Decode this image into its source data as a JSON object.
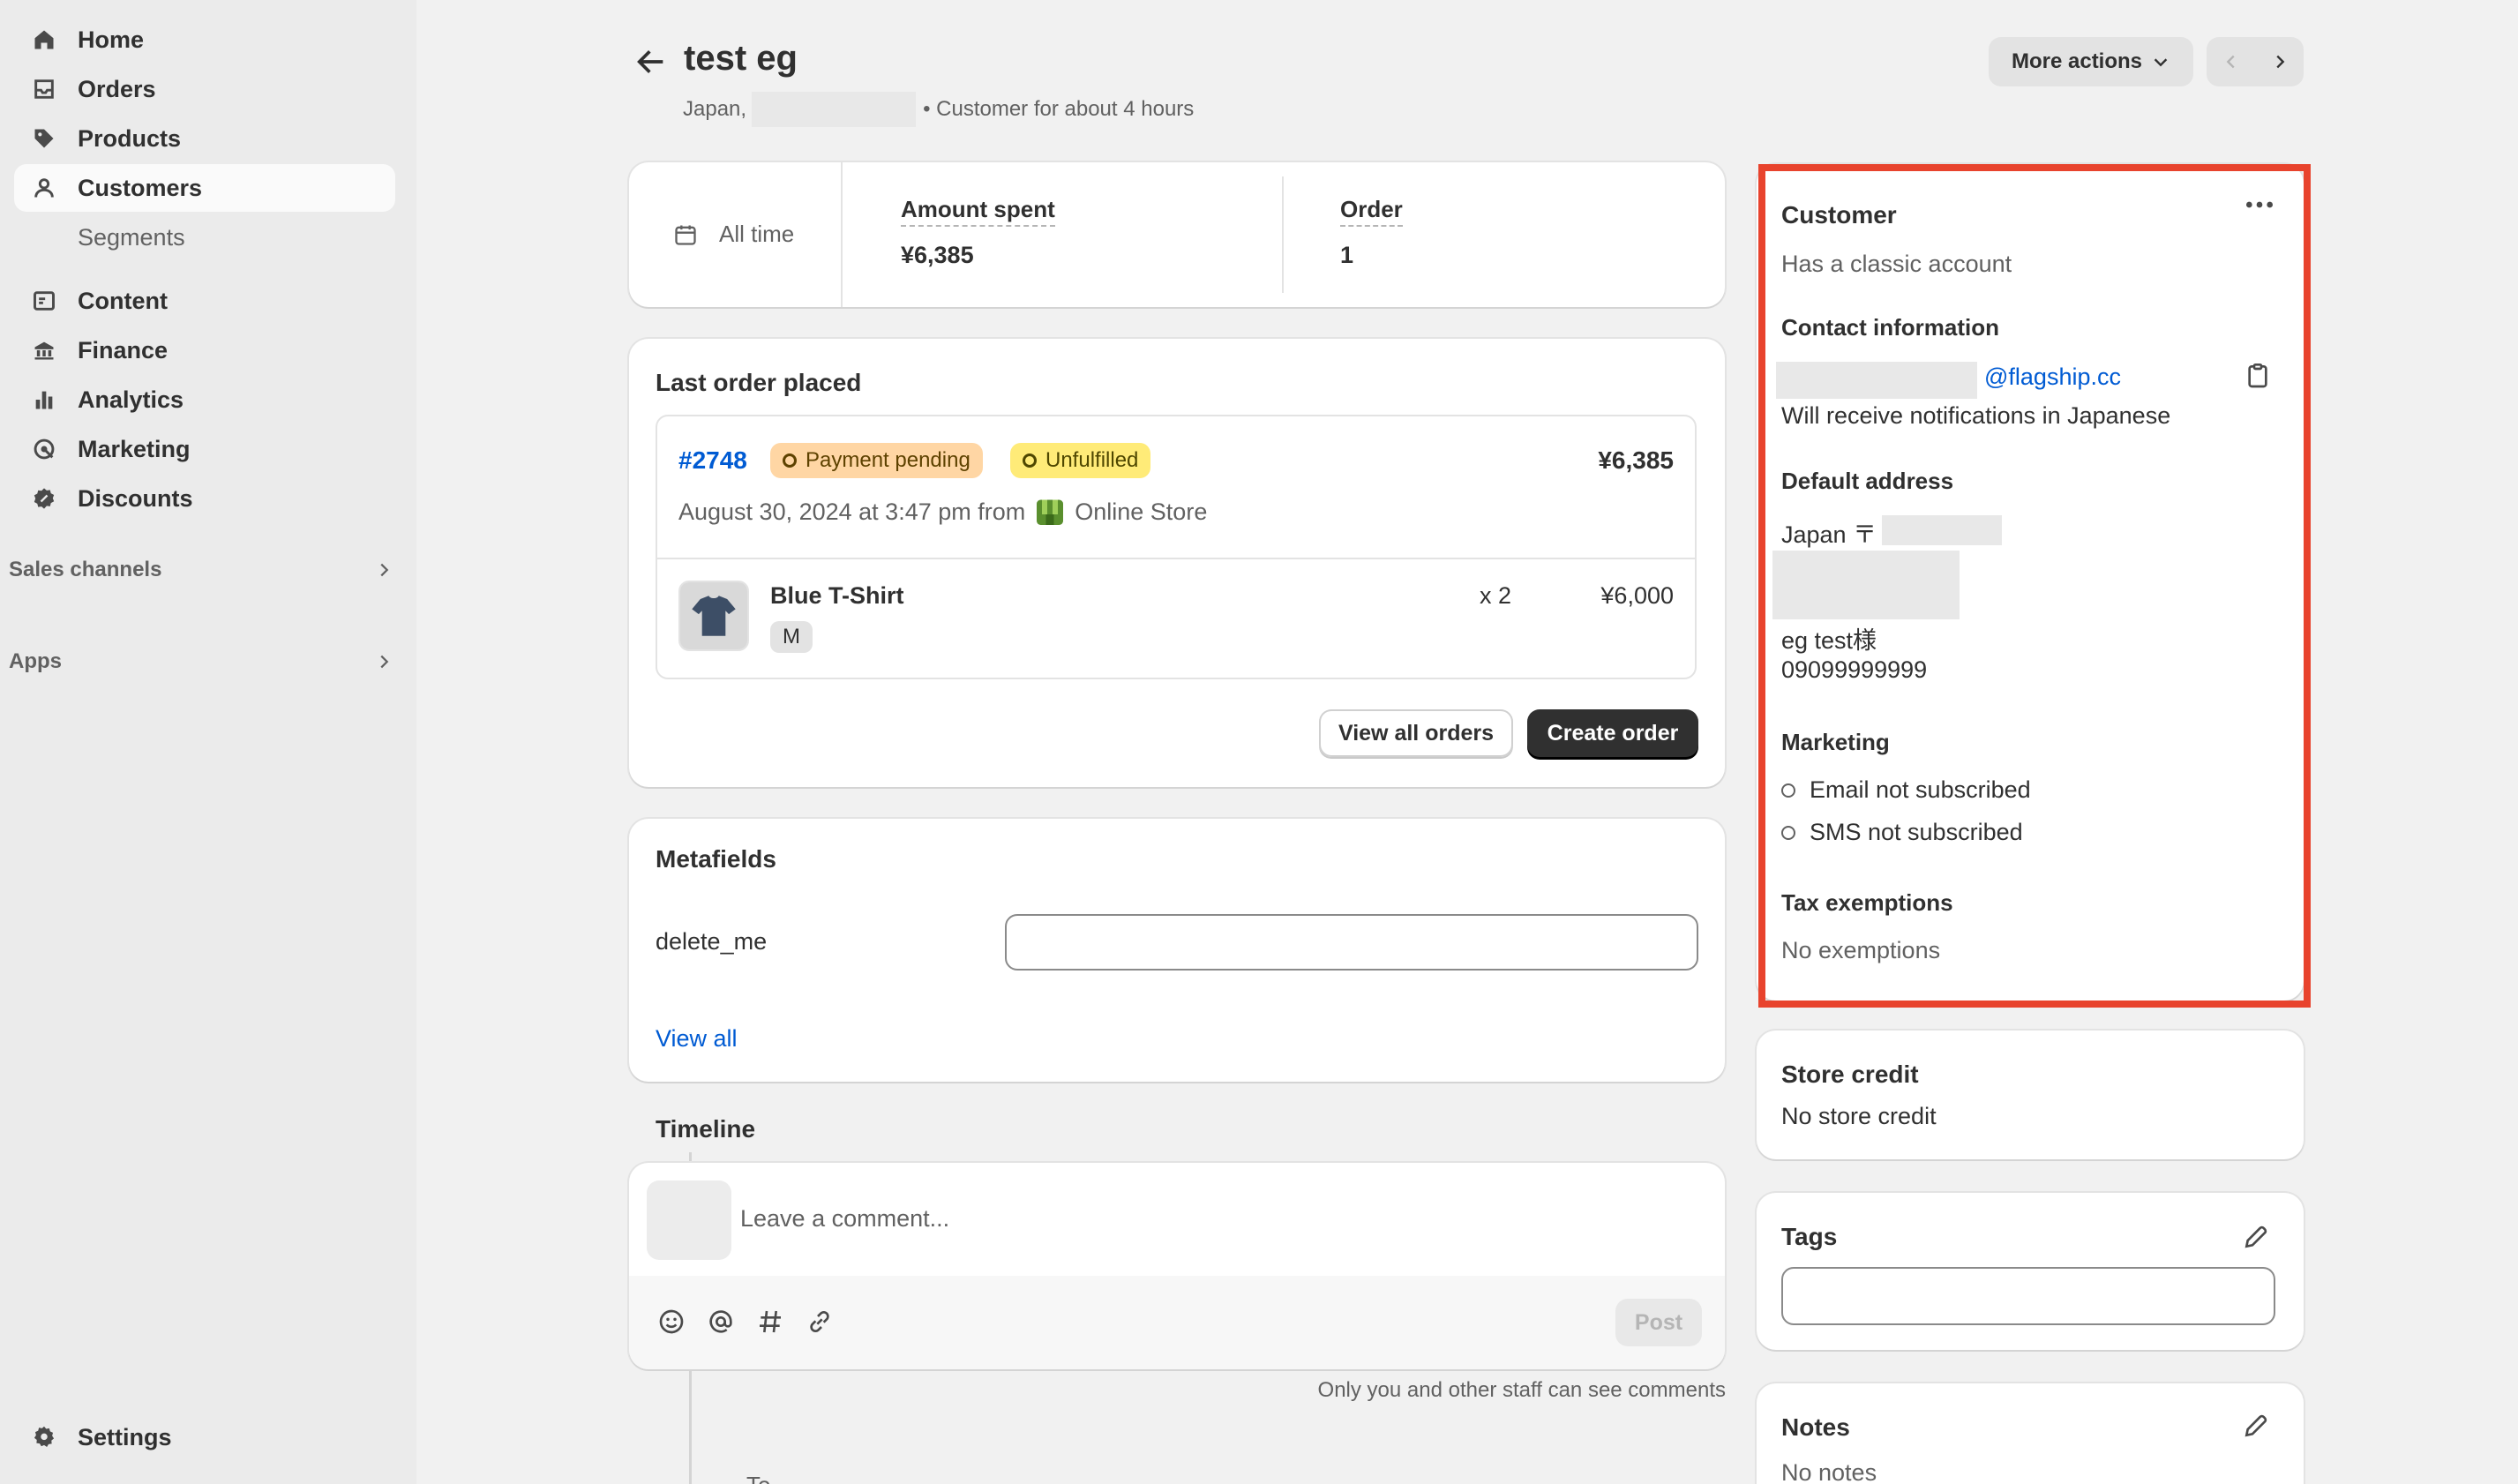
{
  "nav": {
    "home": "Home",
    "orders": "Orders",
    "products": "Products",
    "customers": "Customers",
    "segments": "Segments",
    "content": "Content",
    "finance": "Finance",
    "analytics": "Analytics",
    "marketing": "Marketing",
    "discounts": "Discounts",
    "sales_channels": "Sales channels",
    "apps": "Apps",
    "settings": "Settings"
  },
  "header": {
    "title": "test eg",
    "country": "Japan,",
    "customer_since": "• Customer for about 4 hours",
    "more_actions": "More actions"
  },
  "stats": {
    "period": "All time",
    "amount_label": "Amount spent",
    "amount_value": "¥6,385",
    "order_label": "Order",
    "order_value": "1"
  },
  "last_order": {
    "title": "Last order placed",
    "number": "#2748",
    "payment_status": "Payment pending",
    "fulfillment_status": "Unfulfilled",
    "total": "¥6,385",
    "date_from": "August 30, 2024 at 3:47 pm from",
    "channel": "Online Store",
    "item_name": "Blue T-Shirt",
    "item_variant": "M",
    "item_qty": "x 2",
    "item_price": "¥6,000",
    "view_all": "View all orders",
    "create": "Create order"
  },
  "metafields": {
    "title": "Metafields",
    "field_label": "delete_me",
    "field_value": "",
    "view_all": "View all"
  },
  "timeline": {
    "title": "Timeline",
    "comment_placeholder": "Leave a comment...",
    "post": "Post",
    "note": "Only you and other staff can see comments",
    "partial_text": "To"
  },
  "customer": {
    "title": "Customer",
    "account": "Has a classic account",
    "contact_title": "Contact information",
    "email_domain": "@flagship.cc",
    "notifications": "Will receive notifications in Japanese",
    "address_title": "Default address",
    "address_country": "Japan 〒",
    "address_name": "eg test様",
    "phone": "09099999999",
    "marketing_title": "Marketing",
    "email_marketing": "Email not subscribed",
    "sms_marketing": "SMS not subscribed",
    "tax_title": "Tax exemptions",
    "tax_value": "No exemptions"
  },
  "store_credit": {
    "title": "Store credit",
    "value": "No store credit"
  },
  "tags": {
    "title": "Tags",
    "value": ""
  },
  "notes": {
    "title": "Notes",
    "value": "No notes"
  },
  "colors": {
    "highlight": "#e8432d",
    "link": "#005bd3",
    "payment_badge_bg": "#ffd6a4",
    "fulfillment_badge_bg": "#ffeb78"
  }
}
